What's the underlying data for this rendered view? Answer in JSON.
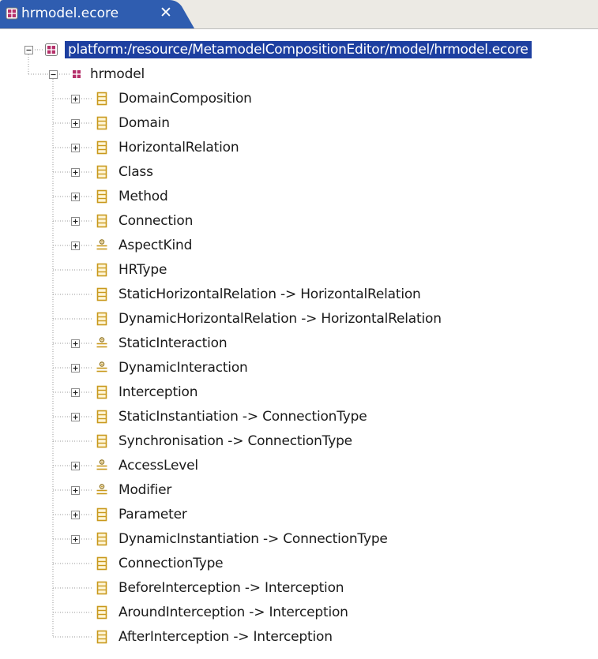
{
  "tab": {
    "title": "hrmodel.ecore",
    "close": "✕",
    "icon": "ecore-package-icon"
  },
  "colors": {
    "tab_active": "#2f5db0",
    "selection": "#1d3fa0",
    "class_icon": "#d4a628",
    "package_icon": "#a0285a",
    "tree_lines": "#9a9a9a"
  },
  "tree": {
    "root": {
      "label": "platform:/resource/MetamodelCompositionEditor/model/hrmodel.ecore",
      "expanded": true,
      "selected": true
    },
    "package": {
      "label": "hrmodel",
      "expanded": true
    },
    "items": [
      {
        "label": "DomainComposition",
        "kind": "class",
        "expandable": true
      },
      {
        "label": "Domain",
        "kind": "class",
        "expandable": true
      },
      {
        "label": "HorizontalRelation",
        "kind": "class",
        "expandable": true
      },
      {
        "label": "Class",
        "kind": "class",
        "expandable": true
      },
      {
        "label": "Method",
        "kind": "class",
        "expandable": true
      },
      {
        "label": "Connection",
        "kind": "class",
        "expandable": true
      },
      {
        "label": "AspectKind",
        "kind": "enum",
        "expandable": true
      },
      {
        "label": "HRType",
        "kind": "class",
        "expandable": false
      },
      {
        "label": "StaticHorizontalRelation -> HorizontalRelation",
        "kind": "class",
        "expandable": false
      },
      {
        "label": "DynamicHorizontalRelation -> HorizontalRelation",
        "kind": "class",
        "expandable": false
      },
      {
        "label": "StaticInteraction",
        "kind": "enum",
        "expandable": true
      },
      {
        "label": "DynamicInteraction",
        "kind": "enum",
        "expandable": true
      },
      {
        "label": "Interception",
        "kind": "class",
        "expandable": true
      },
      {
        "label": "StaticInstantiation -> ConnectionType",
        "kind": "class",
        "expandable": true
      },
      {
        "label": "Synchronisation -> ConnectionType",
        "kind": "class",
        "expandable": false
      },
      {
        "label": "AccessLevel",
        "kind": "enum",
        "expandable": true
      },
      {
        "label": "Modifier",
        "kind": "enum",
        "expandable": true
      },
      {
        "label": "Parameter",
        "kind": "class",
        "expandable": true
      },
      {
        "label": "DynamicInstantiation -> ConnectionType",
        "kind": "class",
        "expandable": true
      },
      {
        "label": "ConnectionType",
        "kind": "class",
        "expandable": false
      },
      {
        "label": "BeforeInterception -> Interception",
        "kind": "class",
        "expandable": false
      },
      {
        "label": "AroundInterception -> Interception",
        "kind": "class",
        "expandable": false
      },
      {
        "label": "AfterInterception -> Interception",
        "kind": "class",
        "expandable": false
      }
    ]
  }
}
